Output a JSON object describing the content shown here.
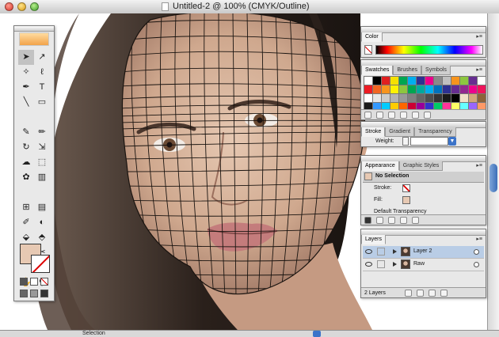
{
  "window": {
    "title": "Untitled-2 @ 100% (CMYK/Outline)"
  },
  "status_bar": {
    "tool": "Selection"
  },
  "toolbox": {
    "tools": [
      {
        "icon": "selection-arrow-icon",
        "glyph": "➤",
        "selected": true
      },
      {
        "icon": "direct-selection-arrow-icon",
        "glyph": "↗",
        "selected": false
      },
      {
        "icon": "magic-wand-icon",
        "glyph": "✧",
        "selected": false
      },
      {
        "icon": "lasso-icon",
        "glyph": "ℓ",
        "selected": false
      },
      {
        "icon": "pen-icon",
        "glyph": "✒",
        "selected": false
      },
      {
        "icon": "type-icon",
        "glyph": "T",
        "selected": false
      },
      {
        "icon": "line-segment-icon",
        "glyph": "╲",
        "selected": false
      },
      {
        "icon": "rectangle-icon",
        "glyph": "▭",
        "selected": false
      },
      {
        "icon": "paintbrush-icon",
        "glyph": "✎",
        "selected": false
      },
      {
        "icon": "pencil-icon",
        "glyph": "✏",
        "selected": false
      },
      {
        "icon": "rotate-icon",
        "glyph": "↻",
        "selected": false
      },
      {
        "icon": "scale-icon",
        "glyph": "⇲",
        "selected": false
      },
      {
        "icon": "warp-icon",
        "glyph": "☁",
        "selected": false
      },
      {
        "icon": "free-transform-icon",
        "glyph": "⬚",
        "selected": false
      },
      {
        "icon": "symbol-sprayer-icon",
        "glyph": "✿",
        "selected": false
      },
      {
        "icon": "column-graph-icon",
        "glyph": "▥",
        "selected": false
      },
      {
        "icon": "mesh-icon",
        "glyph": "⊞",
        "selected": false
      },
      {
        "icon": "gradient-icon",
        "glyph": "▤",
        "selected": false
      },
      {
        "icon": "eyedropper-icon",
        "glyph": "✐",
        "selected": false
      },
      {
        "icon": "blend-icon",
        "glyph": "◐",
        "selected": false
      },
      {
        "icon": "live-paint-bucket-icon",
        "glyph": "⬙",
        "selected": false
      },
      {
        "icon": "live-paint-selection-icon",
        "glyph": "⬘",
        "selected": false
      },
      {
        "icon": "slice-icon",
        "glyph": "✂",
        "selected": false
      },
      {
        "icon": "scissors-icon",
        "glyph": "✂",
        "selected": false
      },
      {
        "icon": "hand-icon",
        "glyph": "✋",
        "selected": false
      },
      {
        "icon": "zoom-icon",
        "glyph": "⚲",
        "selected": false
      }
    ]
  },
  "panels": {
    "color": {
      "tab": "Color"
    },
    "swatches": {
      "tabs": [
        "Swatches",
        "Brushes",
        "Symbols"
      ],
      "rows": [
        [
          "#ffffff",
          "#000000",
          "#e02020",
          "#f5e000",
          "#00a651",
          "#00aeef",
          "#2e3192",
          "#ec008c",
          "#8a8a8a",
          "#c0c0c0",
          "#f7941d",
          "#8dc63f",
          "#662d91",
          "#ffffff"
        ],
        [
          "#ed1c24",
          "#f26522",
          "#f7941d",
          "#fff200",
          "#8dc63f",
          "#00a651",
          "#00a99d",
          "#00aeef",
          "#0072bc",
          "#2e3192",
          "#662d91",
          "#92278f",
          "#ec008c",
          "#ed145b"
        ],
        [
          "#ffffff",
          "#e6e6e6",
          "#cccccc",
          "#b3b3b3",
          "#999999",
          "#808080",
          "#666666",
          "#4d4d4d",
          "#333333",
          "#1a1a1a",
          "#000000",
          "#f0e0c8",
          "#d2a679",
          "#8c6239"
        ],
        [
          "#1a1a1a",
          "#3399ff",
          "#00ccff",
          "#ffcc00",
          "#ff6600",
          "#cc0033",
          "#990099",
          "#3333cc",
          "#00cc66",
          "#ff3399",
          "#ffff66",
          "#66ffff",
          "#9966ff",
          "#ff9966"
        ]
      ]
    },
    "stroke": {
      "tabs": [
        "Stroke",
        "Gradient",
        "Transparency"
      ],
      "weight_label": "Weight:"
    },
    "appearance": {
      "tabs": [
        "Appearance",
        "Graphic Styles"
      ],
      "selection": "No Selection",
      "stroke_label": "Stroke:",
      "fill_label": "Fill:",
      "transparency": "Default Transparency"
    },
    "layers": {
      "tab": "Layers",
      "items": [
        {
          "name": "Layer 2",
          "selected": true
        },
        {
          "name": "Raw",
          "selected": false
        }
      ],
      "count_label": "2 Layers"
    }
  },
  "colors": {
    "fill": "#e7c9b3",
    "accent": "#3b73c9"
  }
}
